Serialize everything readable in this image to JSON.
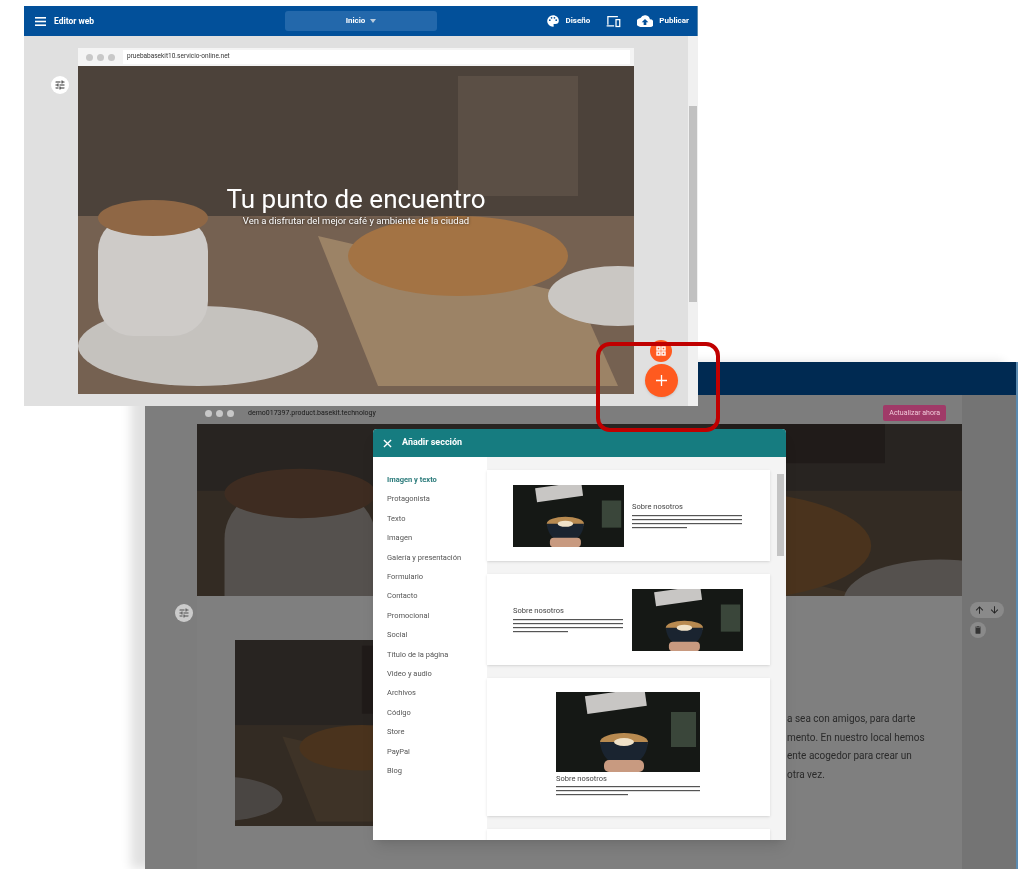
{
  "editor": {
    "title": "Editor web",
    "page_selector": "Inicio",
    "actions": [
      {
        "kind": "design",
        "label": "Diseño"
      },
      {
        "kind": "devices"
      },
      {
        "kind": "publish",
        "label": "Publicar"
      }
    ],
    "url": "pruebabasekit10.servicio-online.net",
    "hero": {
      "title": "Tu punto de encuentro",
      "subtitle": "Ven a disfrutar del mejor café y ambiente de la ciudad"
    }
  },
  "preview": {
    "url": "demo017397.product.basekit.technology",
    "upgrade_button": "Actualizar ahora",
    "body_lines": [
      "a sea con amigos, para darte",
      "mento. En nuestro local hemos",
      "ente acogedor para crear un",
      "otra vez."
    ]
  },
  "dialog": {
    "title": "Añadir sección",
    "categories": [
      {
        "label": "Imagen y texto",
        "selected": true
      },
      {
        "label": "Protagonista",
        "selected": false
      },
      {
        "label": "Texto",
        "selected": false
      },
      {
        "label": "Imagen",
        "selected": false
      },
      {
        "label": "Galería y presentación",
        "selected": false
      },
      {
        "label": "Formulario",
        "selected": false
      },
      {
        "label": "Contacto",
        "selected": false
      },
      {
        "label": "Promocional",
        "selected": false
      },
      {
        "label": "Social",
        "selected": false
      },
      {
        "label": "Título de la página",
        "selected": false
      },
      {
        "label": "Video y audio",
        "selected": false
      },
      {
        "label": "Archivos",
        "selected": false
      },
      {
        "label": "Código",
        "selected": false
      },
      {
        "label": "Store",
        "selected": false
      },
      {
        "label": "PayPal",
        "selected": false
      },
      {
        "label": "Blog",
        "selected": false
      }
    ],
    "templates": [
      {
        "kind": "image-left",
        "heading": "Sobre nosotros"
      },
      {
        "kind": "image-right",
        "heading": "Sobre nosotros"
      },
      {
        "kind": "image-top",
        "heading": "Sobre nosotros"
      },
      {
        "kind": "partial"
      }
    ]
  }
}
